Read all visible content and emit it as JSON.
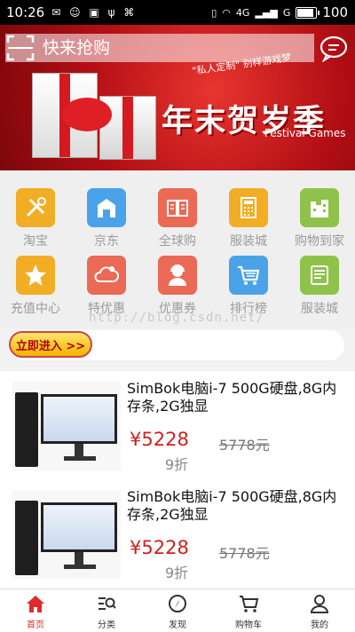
{
  "status_bar": {
    "time": "10:26",
    "icons": [
      "notification-icon",
      "chat-icon",
      "image-icon",
      "usb-icon",
      "code-icon",
      "vibrate-icon",
      "wifi-icon",
      "4g-icon",
      "signal-icon",
      "battery-icon"
    ],
    "network_1": "4G",
    "network_2": "G",
    "battery_pct": "100",
    "battery_level": 1.0
  },
  "banner": {
    "slogan": "\"私人定制\" 别样游戏梦",
    "title": "年末贺岁季",
    "subtitle": "Festival Games"
  },
  "search": {
    "placeholder": "快来抢购"
  },
  "categories": [
    {
      "label": "淘宝",
      "icon": "tools-icon",
      "color": "#f1ad24"
    },
    {
      "label": "京东",
      "icon": "house-icon",
      "color": "#4aa3e8"
    },
    {
      "label": "全球购",
      "icon": "book-icon",
      "color": "#ea6a55"
    },
    {
      "label": "服装城",
      "icon": "calculator-icon",
      "color": "#f1ad24"
    },
    {
      "label": "购物到家",
      "icon": "building-icon",
      "color": "#8fc24a"
    },
    {
      "label": "充值中心",
      "icon": "star-icon",
      "color": "#f1ad24"
    },
    {
      "label": "特优惠",
      "icon": "cloud-icon",
      "color": "#ea6a55"
    },
    {
      "label": "优惠券",
      "icon": "support-icon",
      "color": "#ea6a55"
    },
    {
      "label": "排行榜",
      "icon": "cart-icon",
      "color": "#4aa3e8"
    },
    {
      "label": "服装城",
      "icon": "shop-icon",
      "color": "#8fc24a"
    }
  ],
  "watermark": "http://blog.csdn.net/",
  "enter_button": "立即进入 >>",
  "products": [
    {
      "title": "SimBok电脑i-7 500G硬盘,8G内存条,2G独显",
      "price": "¥5228",
      "original_price": "5778元",
      "discount": "9折"
    },
    {
      "title": "SimBok电脑i-7 500G硬盘,8G内存条,2G独显",
      "price": "¥5228",
      "original_price": "5778元",
      "discount": "9折"
    }
  ],
  "nav": [
    {
      "label": "首页",
      "icon": "home-icon",
      "active": true
    },
    {
      "label": "分类",
      "icon": "category-search-icon",
      "active": false
    },
    {
      "label": "发现",
      "icon": "compass-icon",
      "active": false
    },
    {
      "label": "购物车",
      "icon": "cart-icon",
      "active": false
    },
    {
      "label": "我的",
      "icon": "user-icon",
      "active": false
    }
  ],
  "colors": {
    "accent": "#e12a2a",
    "banner_red": "#c4151b"
  }
}
